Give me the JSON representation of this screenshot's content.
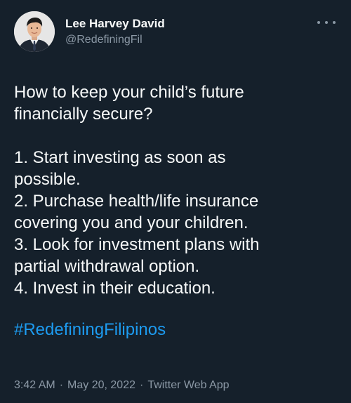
{
  "author": {
    "name": "Lee Harvey David",
    "handle": "@RedefiningFil",
    "avatar_icon": "user-avatar-photo"
  },
  "more_icon": "more-options-icon",
  "tweet": {
    "lines": [
      "How to keep your child’s future",
      "financially secure?",
      "",
      "1. Start investing as soon as",
      "possible.",
      "2. Purchase health/life insurance",
      "covering you and your children.",
      "3. Look for investment plans with",
      "partial withdrawal option.",
      "4. Invest in their education."
    ],
    "hashtag": "#RedefiningFilipinos"
  },
  "meta": {
    "time": "3:42 AM",
    "separator": "·",
    "date": "May 20, 2022",
    "source": "Twitter Web App"
  },
  "colors": {
    "background": "#15202b",
    "text": "#f7f9f9",
    "secondary": "#8b98a5",
    "link": "#1d9bf0"
  }
}
